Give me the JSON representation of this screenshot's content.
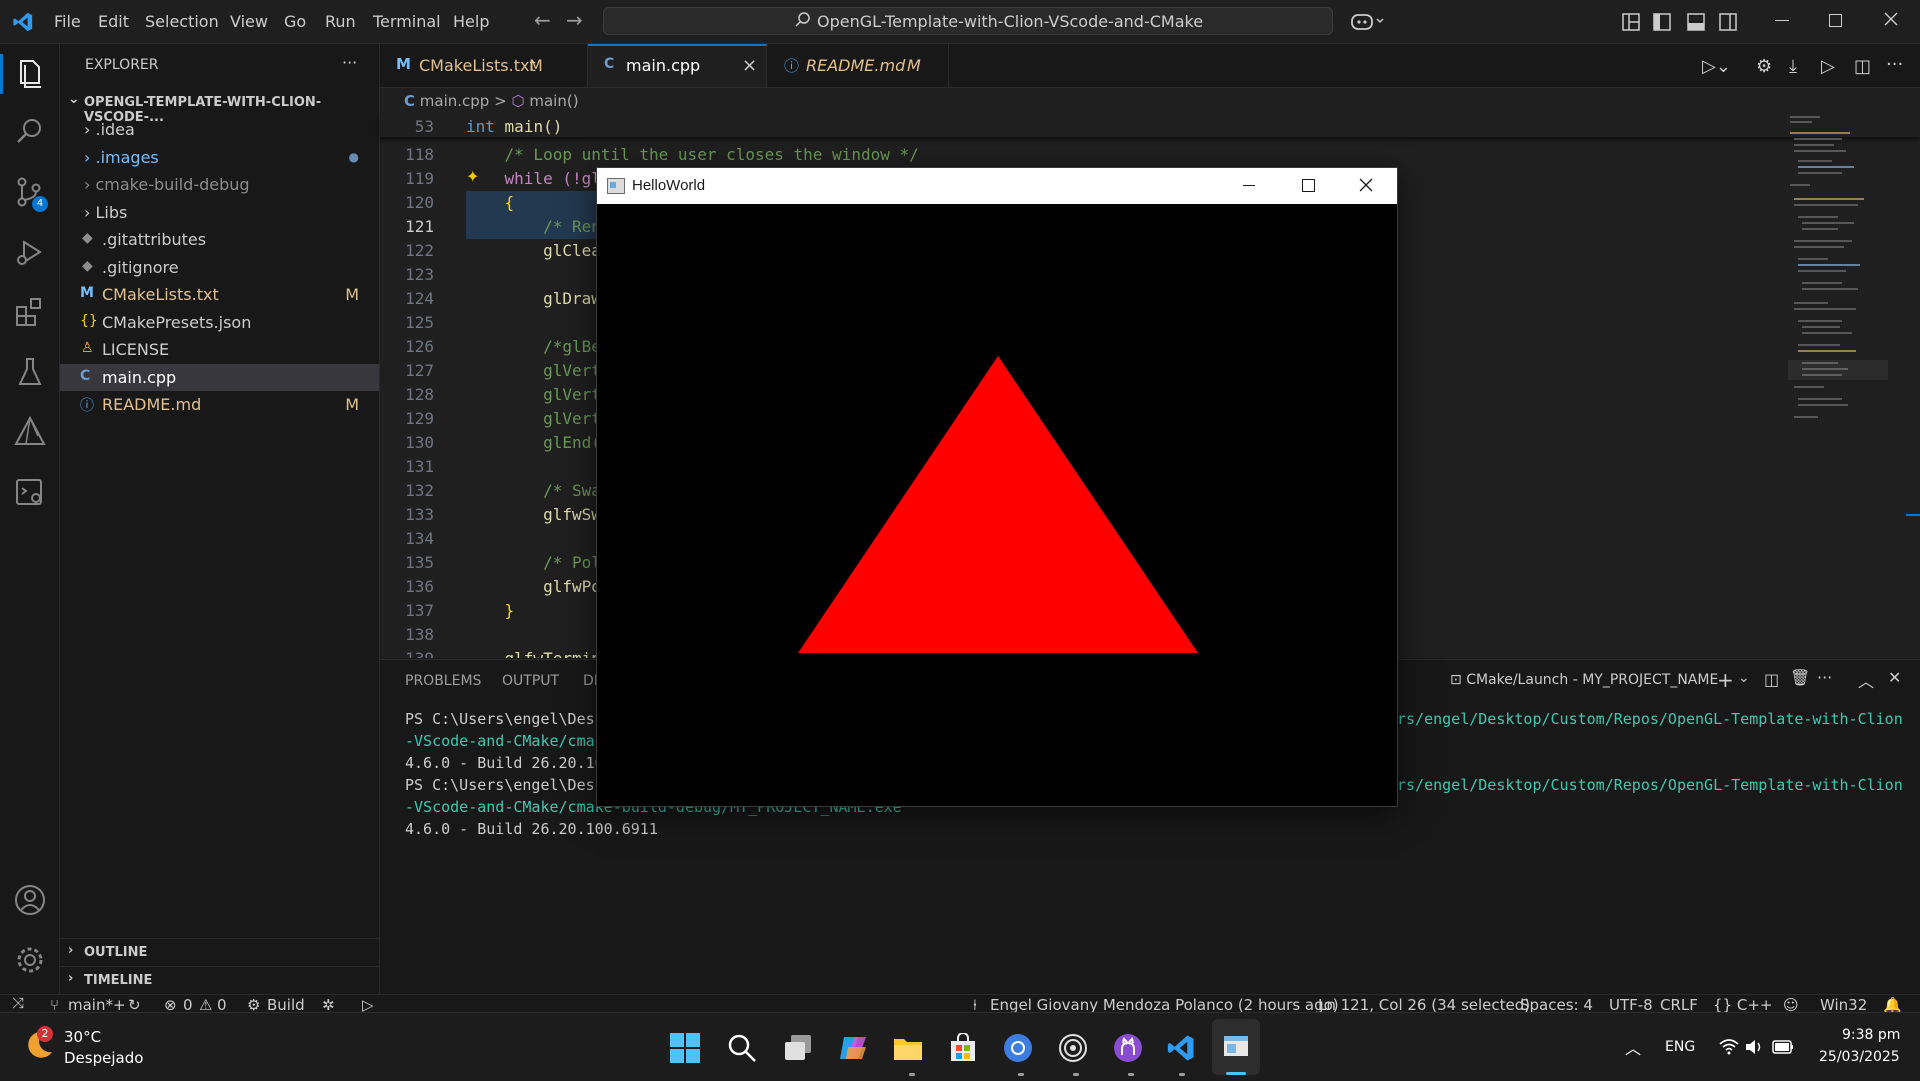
{
  "titlebar": {
    "menu": [
      "File",
      "Edit",
      "Selection",
      "View",
      "Go",
      "Run",
      "Terminal",
      "Help"
    ],
    "search_text": "OpenGL-Template-with-Clion-VScode-and-CMake"
  },
  "explorer": {
    "header": "EXPLORER",
    "more": "···",
    "root": "OPENGL-TEMPLATE-WITH-CLION-VSCODE-...",
    "items": [
      {
        "label": "› .idea",
        "status": ""
      },
      {
        "label": "› .images",
        "status": "●"
      },
      {
        "label": "› cmake-build-debug",
        "status": ""
      },
      {
        "label": "› Libs",
        "status": ""
      },
      {
        "label": ".gitattributes",
        "status": ""
      },
      {
        "label": ".gitignore",
        "status": ""
      },
      {
        "label": "CMakeLists.txt",
        "status": "M"
      },
      {
        "label": "CMakePresets.json",
        "status": ""
      },
      {
        "label": "LICENSE",
        "status": ""
      },
      {
        "label": "main.cpp",
        "status": ""
      },
      {
        "label": "README.md",
        "status": "M"
      }
    ],
    "outline": "OUTLINE",
    "timeline": "TIMELINE"
  },
  "tabs": [
    {
      "label": "CMakeLists.txt",
      "status": "M"
    },
    {
      "label": "main.cpp",
      "status": "×"
    },
    {
      "label": "README.md",
      "status": "M"
    }
  ],
  "breadcrumb": {
    "file": "main.cpp",
    "sep": ">",
    "symbol": "main()"
  },
  "code": {
    "sticky_num": "53",
    "sticky_kw": "int",
    "sticky_fn": "main()",
    "lines": [
      {
        "n": "118",
        "text": "    /* Loop until the user closes the window */"
      },
      {
        "n": "119",
        "text": "    while (!gl"
      },
      {
        "n": "120",
        "text": "    {"
      },
      {
        "n": "121",
        "text": "        /* Ren"
      },
      {
        "n": "122",
        "text": "        glClea"
      },
      {
        "n": "123",
        "text": ""
      },
      {
        "n": "124",
        "text": "        glDraw"
      },
      {
        "n": "125",
        "text": ""
      },
      {
        "n": "126",
        "text": "        /*glBe"
      },
      {
        "n": "127",
        "text": "        glVert"
      },
      {
        "n": "128",
        "text": "        glVert"
      },
      {
        "n": "129",
        "text": "        glVert"
      },
      {
        "n": "130",
        "text": "        glEnd("
      },
      {
        "n": "131",
        "text": ""
      },
      {
        "n": "132",
        "text": "        /* Swa"
      },
      {
        "n": "133",
        "text": "        glfwSw"
      },
      {
        "n": "134",
        "text": ""
      },
      {
        "n": "135",
        "text": "        /* Pol"
      },
      {
        "n": "136",
        "text": "        glfwPo"
      },
      {
        "n": "137",
        "text": "    }"
      },
      {
        "n": "138",
        "text": ""
      },
      {
        "n": "139",
        "text": "    glfwTermin"
      }
    ]
  },
  "panel": {
    "tabs": [
      "PROBLEMS",
      "OUTPUT",
      "DE"
    ],
    "terminal_name": "CMake/Launch - MY_PROJECT_NAME",
    "lines": [
      {
        "left": "PS C:\\Users\\engel\\Desk",
        "right": "rs/engel/Desktop/Custom/Repos/OpenGL-Template-with-Clion"
      },
      {
        "left": "-VScode-and-CMake/cmak",
        "right": ""
      },
      {
        "left": "4.6.0 - Build 26.20.10",
        "right": ""
      },
      {
        "left": "PS C:\\Users\\engel\\Desk",
        "right": "rs/engel/Desktop/Custom/Repos/OpenGL-Template-with-Clion"
      },
      {
        "left": "-VScode-and-CMake/cmake-build-debug/MY_PROJECT_NAME.exe",
        "right": ""
      },
      {
        "left": "4.6.0 - Build 26.20.100.6911",
        "right": ""
      }
    ]
  },
  "statusbar": {
    "branch": "main*+",
    "errors": "0",
    "warnings": "0",
    "build": "Build",
    "blame": "Engel Giovany Mendoza Polanco (2 hours ago)",
    "position": "Ln 121, Col 26 (34 selected)",
    "spaces": "Spaces: 4",
    "encoding": "UTF-8",
    "eol": "CRLF",
    "language": "{} C++",
    "platform": "Win32"
  },
  "glwindow": {
    "title": "HelloWorld",
    "triangle_color": "#ff0000"
  },
  "taskbar": {
    "weather_temp": "30°C",
    "weather_desc": "Despejado",
    "weather_badge": "2",
    "lang": "ENG",
    "time": "9:38 pm",
    "date": "25/03/2025"
  },
  "colors": {
    "accent": "#0078d4",
    "modified": "#e2c08d",
    "string": "#3dc9b0",
    "keyword": "#569cd6"
  }
}
